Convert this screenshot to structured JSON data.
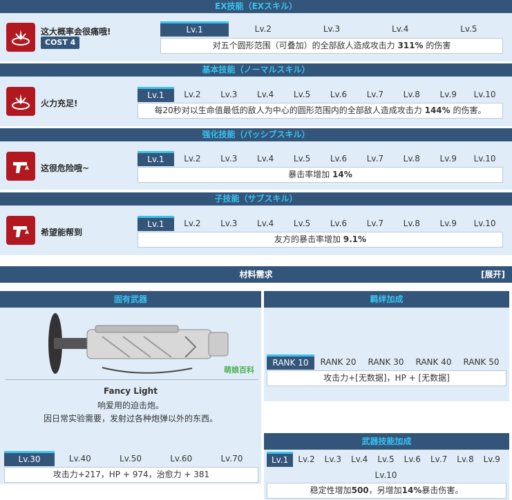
{
  "ex": {
    "header": "EX技能（EXスキル）",
    "name": "这大概率会很痛哦!",
    "cost": "COST 4",
    "levels": [
      "Lv.1",
      "Lv.2",
      "Lv.3",
      "Lv.4",
      "Lv.5"
    ],
    "desc_pre": "对五个圆形范围（可叠加）的全部敌人造成攻击力 ",
    "desc_val": "311%",
    "desc_post": " 的伤害"
  },
  "basic": {
    "header": "基本技能（ノーマルスキル）",
    "name": "火力充足!",
    "levels": [
      "Lv.1",
      "Lv.2",
      "Lv.3",
      "Lv.4",
      "Lv.5",
      "Lv.6",
      "Lv.7",
      "Lv.8",
      "Lv.9",
      "Lv.10"
    ],
    "desc_pre": "每20秒对以生命值最低的敌人为中心的圆形范围内的全部敌人造成攻击力 ",
    "desc_val": "144%",
    "desc_post": " 的伤害。"
  },
  "enhanced": {
    "header": "强化技能（パッシブスキル）",
    "name": "这很危险哦~",
    "levels": [
      "Lv.1",
      "Lv.2",
      "Lv.3",
      "Lv.4",
      "Lv.5",
      "Lv.6",
      "Lv.7",
      "Lv.8",
      "Lv.9",
      "Lv.10"
    ],
    "desc_pre": "暴击率增加 ",
    "desc_val": "14%",
    "desc_post": ""
  },
  "sub": {
    "header": "子技能（サブスキル）",
    "name": "希望能帮到",
    "levels": [
      "Lv.1",
      "Lv.2",
      "Lv.3",
      "Lv.4",
      "Lv.5",
      "Lv.6",
      "Lv.7",
      "Lv.8",
      "Lv.9",
      "Lv.10"
    ],
    "desc_pre": "友方的暴击率增加 ",
    "desc_val": "9.1%",
    "desc_post": ""
  },
  "materials": {
    "title": "材料需求",
    "expand": "[展开]"
  },
  "weapon": {
    "header": "固有武器",
    "name": "Fancy Light",
    "line1": "响爱用的迫击炮。",
    "line2": "因日常实验需要，发射过各种炮弹以外的东西。",
    "watermark": "萌娘百科",
    "levels": [
      "Lv.30",
      "Lv.40",
      "Lv.50",
      "Lv.60",
      "Lv.70"
    ],
    "stats": "攻击力+217，HP + 974，治愈力 + 381"
  },
  "bond": {
    "header": "羁绊加成",
    "ranks": [
      "RANK 10",
      "RANK 20",
      "RANK 30",
      "RANK 40",
      "RANK 50"
    ],
    "stats": "攻击力+[无数据]，HP + [无数据]"
  },
  "weapon_skill": {
    "header": "武器技能加成",
    "levels_row1": [
      "Lv.1",
      "Lv.2",
      "Lv.3",
      "Lv.4",
      "Lv.5",
      "Lv.6",
      "Lv.7",
      "Lv.8",
      "Lv.9"
    ],
    "level10": "Lv.10",
    "desc_pre": "稳定性增加",
    "desc_val1": "500",
    "desc_mid": "，另增加",
    "desc_val2": "14%",
    "desc_post": "暴击伤害。"
  },
  "colors": {
    "header_bg": "#34557a",
    "header_text": "#39c2f0",
    "panel_bg": "#e0edf8",
    "icon_bg": "#b11820"
  }
}
